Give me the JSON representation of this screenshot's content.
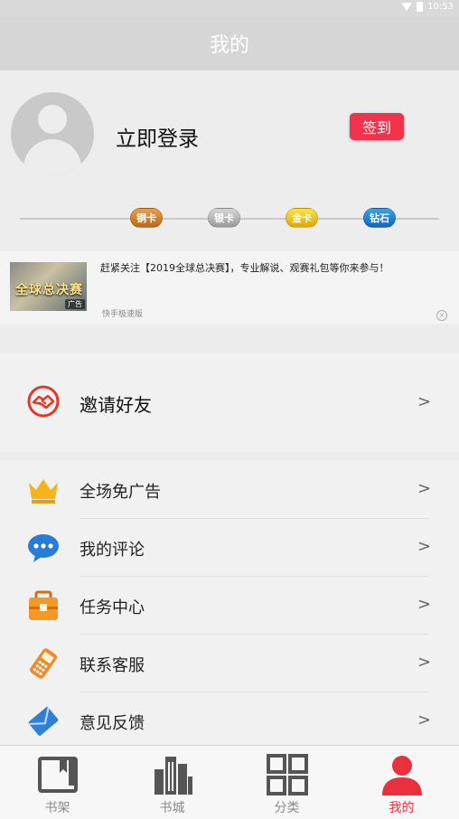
{
  "status_bar": {
    "time": "10:53"
  },
  "header": {
    "title": "我的"
  },
  "profile": {
    "login_text": "立即登录",
    "signin_label": "签到",
    "levels": [
      "铜卡",
      "银卡",
      "金卡",
      "钻石"
    ]
  },
  "ad": {
    "thumb_text": "全球总决赛",
    "ad_tag": "广告",
    "text": "赶紧关注【2019全球总决赛】，专业解说、观赛礼包等你来参与！",
    "source": "快手极速版",
    "close": "×"
  },
  "invite": {
    "label": "邀请好友",
    "arrow": ">"
  },
  "menu": [
    {
      "label": "全场免广告",
      "arrow": ">"
    },
    {
      "label": "我的评论",
      "arrow": ">"
    },
    {
      "label": "任务中心",
      "arrow": ">"
    },
    {
      "label": "联系客服",
      "arrow": ">"
    },
    {
      "label": "意见反馈",
      "arrow": ">"
    }
  ],
  "bottom_nav": [
    {
      "label": "书架",
      "icon": "bookshelf-icon",
      "active": false
    },
    {
      "label": "书城",
      "icon": "bookstore-icon",
      "active": false
    },
    {
      "label": "分类",
      "icon": "category-icon",
      "active": false
    },
    {
      "label": "我的",
      "icon": "profile-icon",
      "active": true
    }
  ],
  "colors": {
    "accent": "#e8303f",
    "signin": "#f0334a",
    "header": "#d6d6d6"
  }
}
